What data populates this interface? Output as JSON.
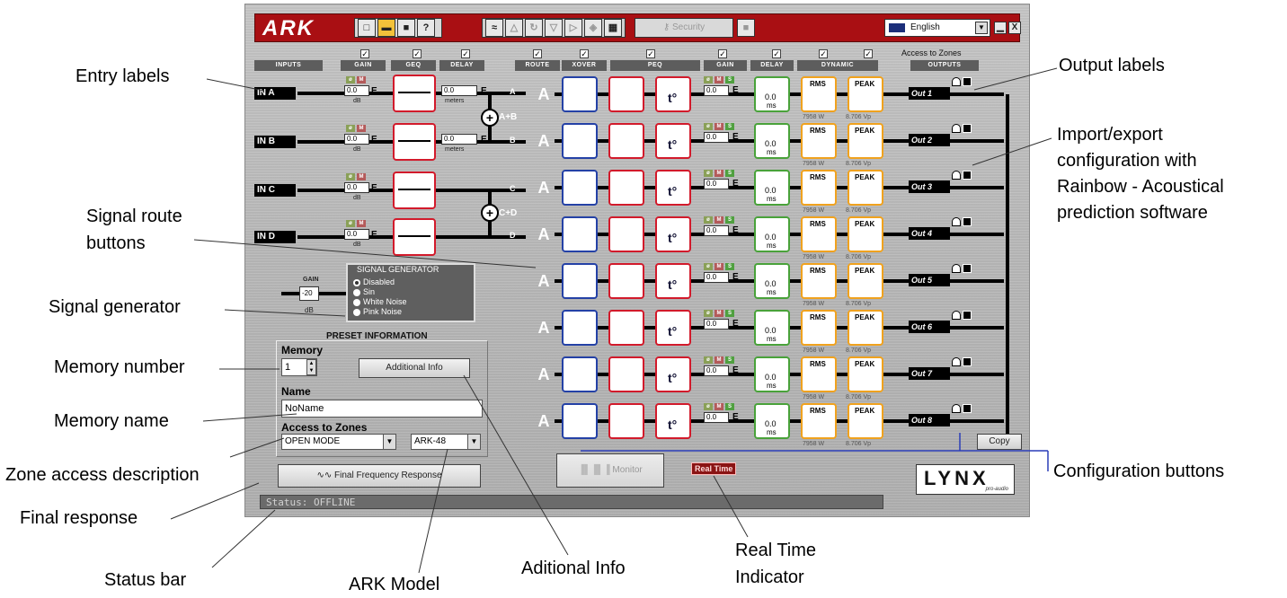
{
  "toolbar": {
    "logo": "ARK",
    "security_label": "Security",
    "language": "English"
  },
  "headers": {
    "inputs": "INPUTS",
    "gain": "GAIN",
    "geq": "GEQ",
    "delay": "DELAY",
    "route": "ROUTE",
    "xover": "XOVER",
    "peq": "PEQ",
    "gain2": "GAIN",
    "delay2": "DELAY",
    "dynamic": "DYNAMIC",
    "outputs": "OUTPUTS",
    "access_to_zones": "Access to Zones"
  },
  "inputs": [
    {
      "label": "IN A",
      "gain": "0.0",
      "unit": "dB",
      "delay": "0.0",
      "delay_unit": "meters",
      "route": "A"
    },
    {
      "label": "IN B",
      "gain": "0.0",
      "unit": "dB",
      "delay": "0.0",
      "delay_unit": "meters",
      "route": "B"
    },
    {
      "label": "IN C",
      "gain": "0.0",
      "unit": "dB",
      "route": "C"
    },
    {
      "label": "IN D",
      "gain": "0.0",
      "unit": "dB",
      "route": "D"
    }
  ],
  "sums": {
    "ab": "A+B",
    "cd": "C+D"
  },
  "outputs": [
    {
      "label": "Out 1",
      "route": "A",
      "gain": "0.0",
      "delay": "0.0",
      "delay_unit": "ms",
      "rms": "RMS",
      "peak": "PEAK",
      "rms_val": "7958 W",
      "peak_val": "8.706 Vp"
    },
    {
      "label": "Out 2",
      "route": "A",
      "gain": "0.0",
      "delay": "0.0",
      "delay_unit": "ms",
      "rms": "RMS",
      "peak": "PEAK",
      "rms_val": "7958 W",
      "peak_val": "8.706 Vp"
    },
    {
      "label": "Out 3",
      "route": "A",
      "gain": "0.0",
      "delay": "0.0",
      "delay_unit": "ms",
      "rms": "RMS",
      "peak": "PEAK",
      "rms_val": "7958 W",
      "peak_val": "8.706 Vp"
    },
    {
      "label": "Out 4",
      "route": "A",
      "gain": "0.0",
      "delay": "0.0",
      "delay_unit": "ms",
      "rms": "RMS",
      "peak": "PEAK",
      "rms_val": "7958 W",
      "peak_val": "8.706 Vp"
    },
    {
      "label": "Out 5",
      "route": "A",
      "gain": "0.0",
      "delay": "0.0",
      "delay_unit": "ms",
      "rms": "RMS",
      "peak": "PEAK",
      "rms_val": "7958 W",
      "peak_val": "8.706 Vp"
    },
    {
      "label": "Out 6",
      "route": "A",
      "gain": "0.0",
      "delay": "0.0",
      "delay_unit": "ms",
      "rms": "RMS",
      "peak": "PEAK",
      "rms_val": "7958 W",
      "peak_val": "8.706 Vp"
    },
    {
      "label": "Out 7",
      "route": "A",
      "gain": "0.0",
      "delay": "0.0",
      "delay_unit": "ms",
      "rms": "RMS",
      "peak": "PEAK",
      "rms_val": "7958 W",
      "peak_val": "8.706 Vp"
    },
    {
      "label": "Out 8",
      "route": "A",
      "gain": "0.0",
      "delay": "0.0",
      "delay_unit": "ms",
      "rms": "RMS",
      "peak": "PEAK",
      "rms_val": "7958 W",
      "peak_val": "8.706 Vp"
    }
  ],
  "generator": {
    "title": "SIGNAL GENERATOR",
    "gain_label": "GAIN",
    "gain": "-20",
    "unit": "dB",
    "options": [
      "Disabled",
      "Sin",
      "White Noise",
      "Pink Noise"
    ]
  },
  "preset": {
    "title": "PRESET INFORMATION",
    "memory_label": "Memory",
    "memory": "1",
    "additional_info": "Additional Info",
    "name_label": "Name",
    "name": "NoName",
    "access_label": "Access to Zones",
    "access": "OPEN MODE",
    "model": "ARK-48",
    "final_response": "Final Frequency Response"
  },
  "monitor": "Monitor",
  "realtime": "Real Time",
  "copy": "Copy",
  "status": "Status:  OFFLINE",
  "brand": {
    "name": "LYNX",
    "sub": "pro-audio"
  },
  "callouts": {
    "entry_labels": "Entry labels",
    "signal_route": "Signal route\nbuttons",
    "signal_generator": "Signal generator",
    "memory_number": "Memory number",
    "memory_name": "Memory name",
    "zone_access": "Zone access description",
    "final_response": "Final response",
    "status_bar": "Status bar",
    "ark_model": "ARK Model",
    "aditional_info": "Aditional Info",
    "real_time": "Real Time\nIndicator",
    "configuration": "Configuration buttons",
    "output_labels": "Output labels",
    "import_export": "Import/export\nconfiguration with\nRainbow - Acoustical\nprediction software"
  }
}
